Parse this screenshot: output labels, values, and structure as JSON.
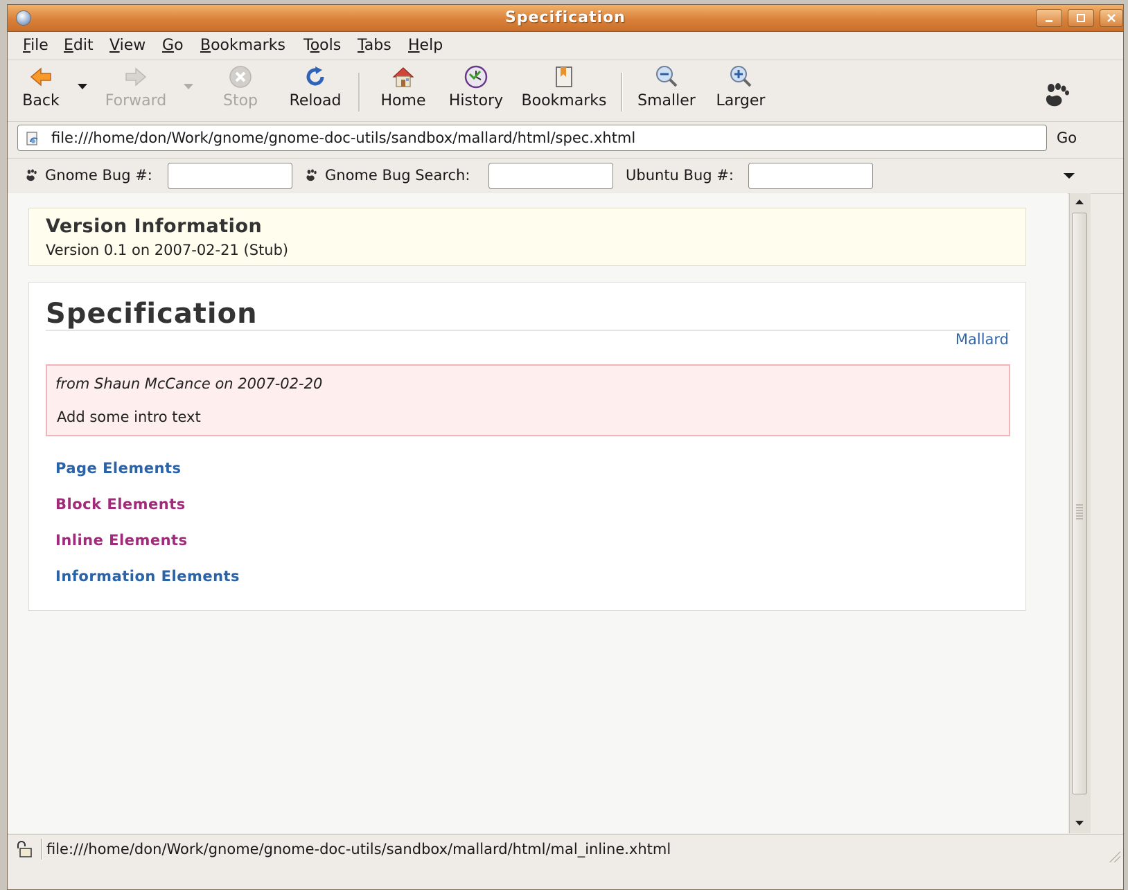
{
  "window": {
    "title": "Specification"
  },
  "menubar": {
    "items": [
      {
        "label": "File",
        "accel": "F",
        "rest": "ile"
      },
      {
        "label": "Edit",
        "accel": "E",
        "rest": "dit"
      },
      {
        "label": "View",
        "accel": "V",
        "rest": "iew"
      },
      {
        "label": "Go",
        "accel": "G",
        "rest": "o"
      },
      {
        "label": "Bookmarks",
        "accel": "B",
        "rest": "ookmarks"
      },
      {
        "label": "Tools",
        "accel": "o",
        "pre": "T",
        "rest": "ols"
      },
      {
        "label": "Tabs",
        "accel": "T",
        "rest": "abs"
      },
      {
        "label": "Help",
        "accel": "H",
        "rest": "elp"
      }
    ]
  },
  "toolbar": {
    "back": "Back",
    "forward": "Forward",
    "stop": "Stop",
    "reload": "Reload",
    "home": "Home",
    "history": "History",
    "bookmarks": "Bookmarks",
    "smaller": "Smaller",
    "larger": "Larger"
  },
  "urlbar": {
    "url": "file:///home/don/Work/gnome/gnome-doc-utils/sandbox/mallard/html/spec.xhtml",
    "go": "Go"
  },
  "bugbar": {
    "gnome_bug_label": "Gnome Bug #:",
    "gnome_search_label": "Gnome Bug Search:",
    "ubuntu_bug_label": "Ubuntu Bug #:"
  },
  "page": {
    "version_title": "Version Information",
    "version_text": "Version 0.1 on 2007-02-21 (Stub)",
    "title": "Specification",
    "breadcrumb_link": "Mallard",
    "note_from": "from Shaun McCance on 2007-02-20",
    "note_text": "Add some intro text",
    "links": [
      {
        "label": "Page Elements",
        "visited": false
      },
      {
        "label": "Block Elements",
        "visited": true
      },
      {
        "label": "Inline Elements",
        "visited": true
      },
      {
        "label": "Information Elements",
        "visited": false
      }
    ]
  },
  "statusbar": {
    "text": "file:///home/don/Work/gnome/gnome-doc-utils/sandbox/mallard/html/mal_inline.xhtml"
  },
  "colors": {
    "titlebar": "#d9813a",
    "link_unvisited": "#2a63a8",
    "link_visited": "#a12b7a",
    "note_bg": "#ffeeee",
    "note_border": "#f0b5b8",
    "version_bg": "#fffdee"
  }
}
